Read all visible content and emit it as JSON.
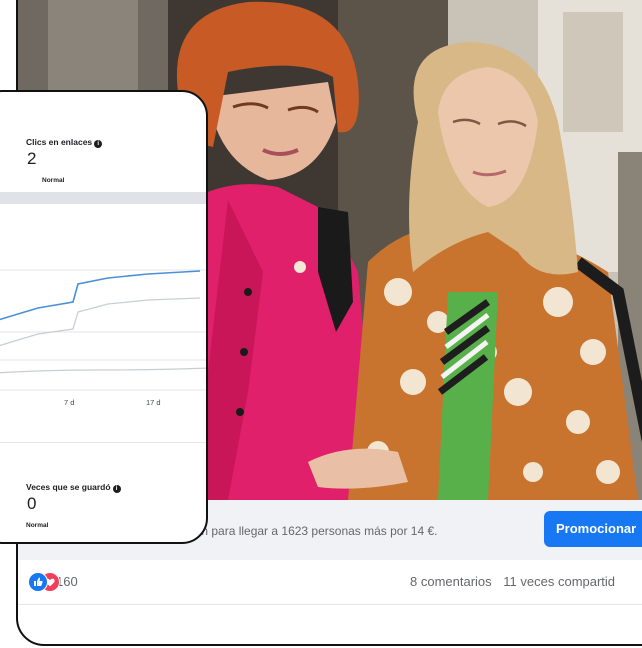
{
  "post": {
    "promo_text": "ción para llegar a 1623 personas más por 14 €.",
    "promote_button": "Promocionar",
    "reaction_count": "160",
    "comments": "8 comentarios",
    "shares": "11 veces compartid"
  },
  "insights": {
    "link_clicks": {
      "title": "Clics en enlaces",
      "value": "2",
      "status": "Normal"
    },
    "saves": {
      "title": "Veces que se guardó",
      "value": "0",
      "status": "Normal"
    },
    "chart_ticks": [
      "7 d",
      "17 d"
    ]
  },
  "colors": {
    "accent": "#1877f2",
    "love": "#f33e58",
    "line_primary": "#4a90d9",
    "line_secondary": "#c9ced6"
  }
}
